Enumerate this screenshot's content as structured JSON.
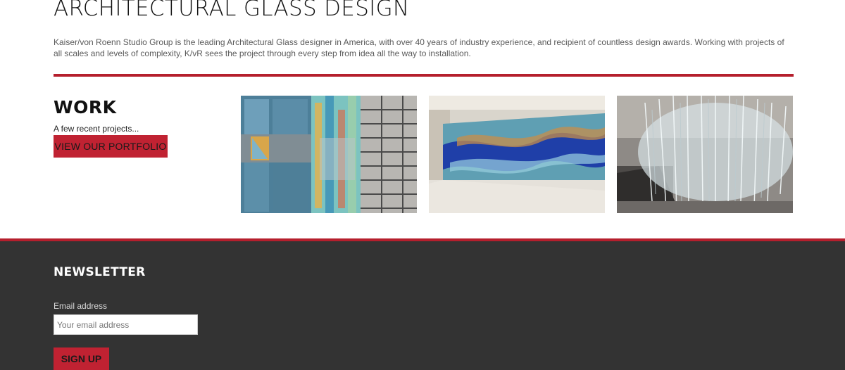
{
  "hero": {
    "title": "ARCHITECTURAL GLASS DESIGN",
    "intro": "Kaiser/von Roenn Studio Group is the leading Architectural Glass designer in America, with over 40 years of industry experience, and recipient of countless design awards. Working with projects of all scales and levels of complexity, K/vR sees the project through every step from idea all the way to installation."
  },
  "work": {
    "title": "WORK",
    "subtitle": "A few recent projects...",
    "portfolio_button": "VIEW OUR PORTFOLIO",
    "projects": [
      {
        "image": "stained-glass-facade-photo"
      },
      {
        "image": "blue-glass-wall-lobby-photo"
      },
      {
        "image": "glass-chandelier-atrium-photo"
      }
    ]
  },
  "newsletter": {
    "title": "NEWSLETTER",
    "email_label": "Email address",
    "email_placeholder": "Your email address",
    "email_value": "",
    "signup_button": "SIGN UP"
  },
  "colors": {
    "accent": "#b51f2d",
    "button": "#c02232",
    "footer_bg": "#333333"
  }
}
